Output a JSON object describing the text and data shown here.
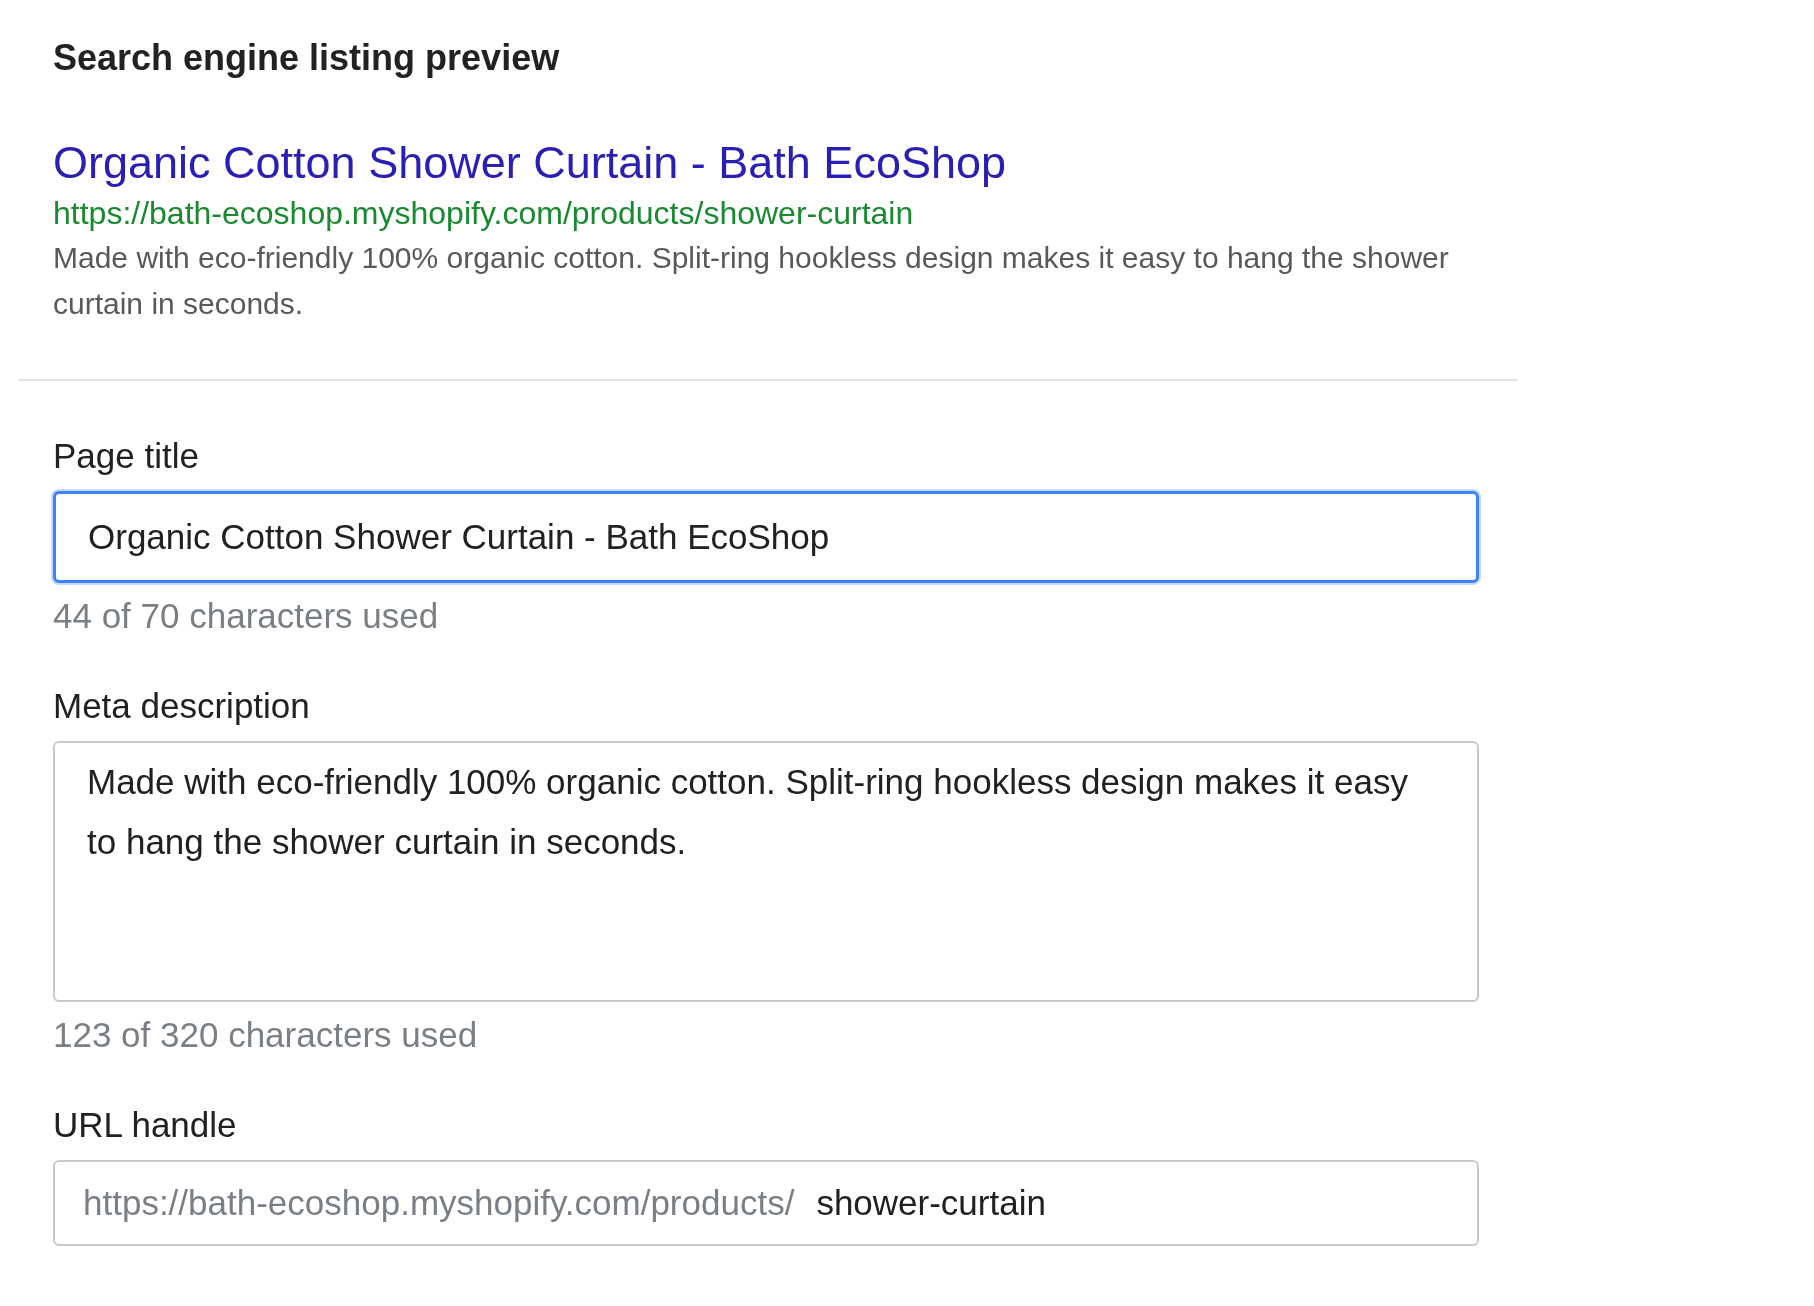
{
  "heading": "Search engine listing preview",
  "preview": {
    "title": "Organic Cotton Shower Curtain - Bath EcoShop",
    "url": "https://bath-ecoshop.myshopify.com/products/shower-curtain",
    "description": "Made with eco-friendly 100% organic cotton. Split-ring hookless design makes it easy to hang the shower curtain in seconds."
  },
  "page_title": {
    "label": "Page title",
    "value": "Organic Cotton Shower Curtain - Bath EcoShop",
    "focused": true,
    "help": "44 of 70 characters used"
  },
  "meta_description": {
    "label": "Meta description",
    "value": "Made with eco-friendly 100% organic cotton. Split-ring hookless design makes it easy to hang the shower curtain in seconds.",
    "focused": false,
    "help": "123 of 320 characters used"
  },
  "url_handle": {
    "label": "URL handle",
    "prefix": "https://bath-ecoshop.myshopify.com/products/",
    "value": "shower-curtain",
    "focused": false
  }
}
